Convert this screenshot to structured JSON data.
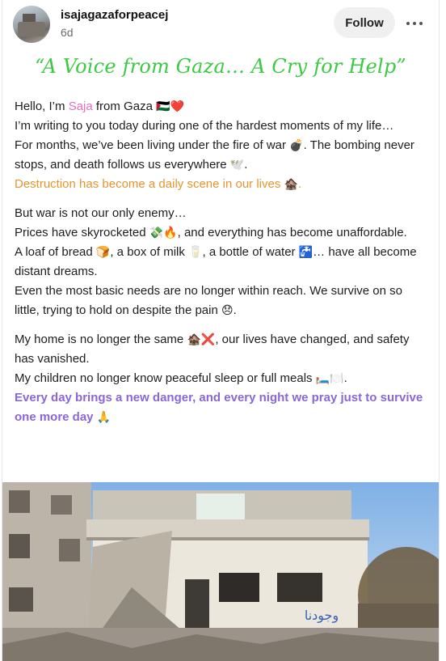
{
  "post": {
    "username": "isajagazaforpeacej",
    "time": "6d",
    "follow_label": "Follow",
    "title": "“A Voice from Gaza… A Cry for Help”",
    "paragraphs": [
      [
        {
          "segments": [
            {
              "t": "Hello, I’m "
            },
            {
              "t": "Saja",
              "c": "saja"
            },
            {
              "t": " from Gaza "
            },
            {
              "t": "🇵🇸❤️",
              "c": "emo"
            }
          ]
        },
        {
          "segments": [
            {
              "t": "I’m writing to you today during one of the hardest moments of my life…"
            }
          ]
        },
        {
          "segments": [
            {
              "t": "For months, we’ve been living under the fire of war "
            },
            {
              "t": "💣",
              "c": "emo"
            },
            {
              "t": ". The bombing never stops, and death follows us everywhere "
            },
            {
              "t": "🕊️",
              "c": "emo"
            },
            {
              "t": "."
            }
          ]
        },
        {
          "segments": [
            {
              "t": "Destruction has become a daily scene in our lives ",
              "c": "orange"
            },
            {
              "t": "🏚️",
              "c": "emo"
            },
            {
              "t": ".",
              "c": "orange"
            }
          ]
        }
      ],
      [
        {
          "segments": [
            {
              "t": "But war is not our only enemy…"
            }
          ]
        },
        {
          "segments": [
            {
              "t": "Prices have skyrocketed "
            },
            {
              "t": "💸🔥",
              "c": "emo"
            },
            {
              "t": ", and everything has become unaffordable."
            }
          ]
        },
        {
          "segments": [
            {
              "t": "A loaf of bread "
            },
            {
              "t": "🍞",
              "c": "emo"
            },
            {
              "t": ", a box of milk "
            },
            {
              "t": "🥛",
              "c": "emo"
            },
            {
              "t": ", a bottle of water "
            },
            {
              "t": "🚰",
              "c": "emo"
            },
            {
              "t": "… have all become distant dreams."
            }
          ]
        },
        {
          "segments": [
            {
              "t": "Even the most basic needs are no longer within reach. We survive on so little, trying to hold on despite the pain "
            },
            {
              "t": "😞",
              "c": "emo"
            },
            {
              "t": "."
            }
          ]
        }
      ],
      [
        {
          "segments": [
            {
              "t": "My home is no longer the same "
            },
            {
              "t": "🏚️❌",
              "c": "emo"
            },
            {
              "t": ", our lives have changed, and safety has vanished."
            }
          ]
        },
        {
          "segments": [
            {
              "t": "My children no longer know peaceful sleep or full meals "
            },
            {
              "t": "🛏️🍽️",
              "c": "emo"
            },
            {
              "t": "."
            }
          ]
        },
        {
          "segments": [
            {
              "t": "Every day brings a new danger, and every night we pray just to survive one more day ",
              "c": "purple"
            },
            {
              "t": "🙏",
              "c": "emo"
            }
          ]
        }
      ]
    ],
    "photo_graffiti": "وجودنا"
  }
}
